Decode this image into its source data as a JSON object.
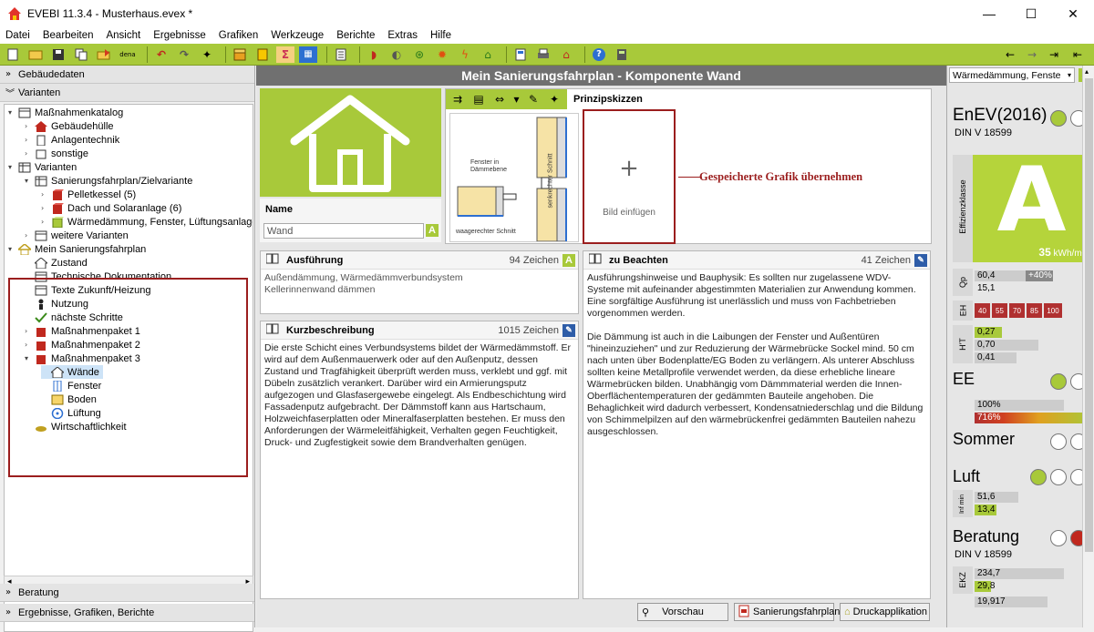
{
  "window": {
    "title": "EVEBI 11.3.4 - Musterhaus.evex *"
  },
  "menu": [
    "Datei",
    "Bearbeiten",
    "Ansicht",
    "Ergebnisse",
    "Grafiken",
    "Werkzeuge",
    "Berichte",
    "Extras",
    "Hilfe"
  ],
  "toolbar": {
    "dena_label": "dena"
  },
  "left": {
    "sections": {
      "gebaeudedaten": "Gebäudedaten",
      "varianten": "Varianten",
      "beratung": "Beratung",
      "ergebnisse": "Ergebnisse, Grafiken, Berichte"
    },
    "tree": [
      "Maßnahmenkatalog",
      "Gebäudehülle",
      "Anlagentechnik",
      "sonstige",
      "Varianten",
      "Sanierungsfahrplan/Zielvariante",
      "Pelletkessel (5)",
      "Dach und Solaranlage (6)",
      "Wärmedämmung, Fenster, Lüftungsanlage",
      "weitere Varianten",
      "Mein Sanierungsfahrplan",
      "Zustand",
      "Technische Dokumentation",
      "Texte Zukunft/Heizung",
      "Nutzung",
      "nächste Schritte",
      "Maßnahmenpaket 1",
      "Maßnahmenpaket 2",
      "Maßnahmenpaket 3",
      "Wände",
      "Fenster",
      "Boden",
      "Lüftung",
      "Wirtschaftlichkeit"
    ]
  },
  "center": {
    "title": "Mein Sanierungsfahrplan - Komponente Wand",
    "name_label": "Name",
    "name_value": "Wand",
    "prinzipskizzen": "Prinzipskizzen",
    "sketch_label1": "Fenster in Dämmebene",
    "sketch_label2": "waagerechter Schnitt",
    "sketch_label3": "senkrechter Schnitt",
    "bild_einfuegen": "Bild einfügen",
    "gespeicherte": "Gespeicherte Grafik übernehmen",
    "ausfuehrung": {
      "title": "Ausführung",
      "count": "94 Zeichen",
      "lines": [
        "Außendämmung, Wärmedämmverbundsystem",
        "Kellerinnenwand dämmen"
      ]
    },
    "kurz": {
      "title": "Kurzbeschreibung",
      "count": "1015 Zeichen",
      "text": "Die erste Schicht eines Verbundsystems bildet der Wärmedämmstoff. Er wird auf dem Außenmauerwerk oder auf den Außenputz, dessen Zustand und Tragfähigkeit überprüft werden muss, verklebt und ggf. mit Dübeln zusätzlich verankert. Darüber wird ein Armierungsputz aufgezogen und Glasfasergewebe eingelegt. Als Endbeschichtung wird Fassadenputz aufgebracht. Der Dämmstoff kann aus Hartschaum, Holzweichfaserplatten oder Mineralfaserplatten bestehen. Er muss den Anforderungen der Wärmeleitfähigkeit, Verhalten gegen Feuchtigkeit, Druck- und Zugfestigkeit sowie dem Brandverhalten genügen."
    },
    "beachten": {
      "title": "zu Beachten",
      "count": "41 Zeichen",
      "p1": "Ausführungshinweise und Bauphysik: Es sollten nur zugelassene WDV-Systeme mit aufeinander abgestimmten Materialien zur Anwendung kommen. Eine sorgfältige Ausführung ist unerlässlich und muss von Fachbetrieben vorgenommen werden.",
      "p2": "Die Dämmung ist auch in die Laibungen der Fenster und Außentüren \"hineinzuziehen\" und zur Reduzierung der Wärmebrücke Sockel mind. 50 cm nach unten über Bodenplatte/EG Boden zu verlängern. Als unterer Abschluss sollten keine Metallprofile verwendet werden, da diese erhebliche lineare Wärmebrücken bilden. Unabhängig vom Dämmmaterial werden die Innen-Oberflächentemperaturen der gedämmten Bauteile angehoben. Die Behaglichkeit wird dadurch verbessert, Kondensatniederschlag und die Bildung von Schimmelpilzen auf den wärmebrückenfrei gedämmten Bauteilen nahezu ausgeschlossen."
    },
    "buttons": {
      "vorschau": "Vorschau",
      "sanierungsfahrplan": "Sanierungsfahrplan",
      "druckapplikation": "Druckapplikation"
    }
  },
  "right": {
    "dropdown": "Wärmedämmung, Fenste",
    "enev": "EnEV(2016)",
    "din1": "DIN V 18599",
    "effizienzklasse": "Effizienzklasse",
    "grade": "A",
    "kwh": "35",
    "kwh_unit": "kWh/m²",
    "qp_label": "Qp",
    "qp1": "60,4",
    "qp_pct": "+40%",
    "qp2": "15,1",
    "eh_label": "EH",
    "eh": [
      "40",
      "55",
      "70",
      "85",
      "100"
    ],
    "ht_label": "H'T",
    "ht": [
      "0,27",
      "0,70",
      "0,41"
    ],
    "ee": "EE",
    "ee1": "100%",
    "ee2": "716%",
    "sommer": "Sommer",
    "luft": "Luft",
    "inf_label": "Inf min",
    "luft1": "51,6",
    "luft2": "13,4",
    "beratung": "Beratung",
    "din2": "DIN V 18599",
    "ekz_label": "EKZ",
    "ekz1": "234,7",
    "ekz2": "29,8",
    "ekz3": "19,917"
  },
  "colors": {
    "accent": "#a8c93a",
    "dark_title": "#707070",
    "red": "#9b1e1e"
  }
}
